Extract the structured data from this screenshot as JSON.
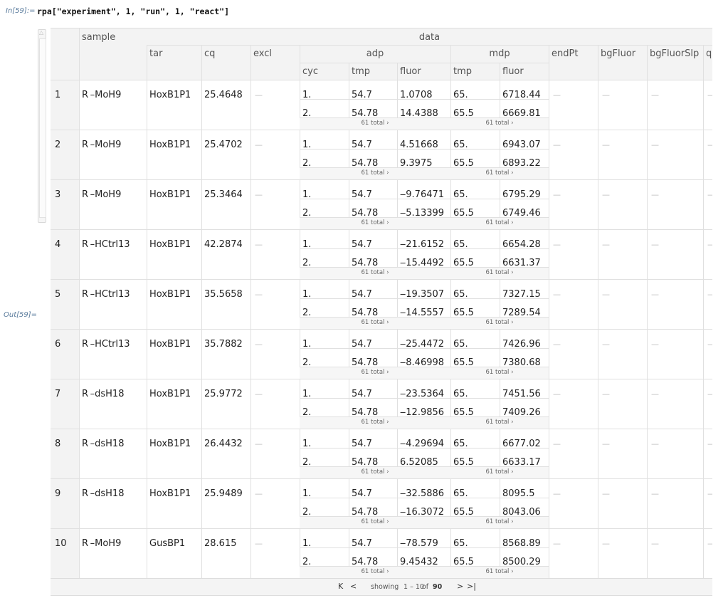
{
  "input": {
    "label": "In[59]:=",
    "code_fn": "rpa",
    "code_args": "[\"experiment\", 1, \"run\", 1, \"react\"]"
  },
  "output": {
    "label": "Out[59]="
  },
  "header": {
    "sample": "sample",
    "data": "data",
    "tar": "tar",
    "cq": "cq",
    "excl": "excl",
    "adp": "adp",
    "mdp": "mdp",
    "endPt": "endPt",
    "bgFluor": "bgFluor",
    "bgFluorSlp": "bgFluorSlp",
    "q": "q",
    "cyc": "cyc",
    "tmp": "tmp",
    "fluor": "fluor"
  },
  "dash": "—",
  "total_label": "61 total ›",
  "rows": [
    {
      "n": "1",
      "sample": "R –MoH9",
      "tar": "HoxB1P1",
      "cq": "25.4648",
      "adp": [
        [
          "1.",
          "54.7",
          "1.0708"
        ],
        [
          "2.",
          "54.78",
          "14.4388"
        ]
      ],
      "mdp": [
        [
          "65.",
          "6718.44"
        ],
        [
          "65.5",
          "6669.81"
        ]
      ]
    },
    {
      "n": "2",
      "sample": "R –MoH9",
      "tar": "HoxB1P1",
      "cq": "25.4702",
      "adp": [
        [
          "1.",
          "54.7",
          "4.51668"
        ],
        [
          "2.",
          "54.78",
          "9.3975"
        ]
      ],
      "mdp": [
        [
          "65.",
          "6943.07"
        ],
        [
          "65.5",
          "6893.22"
        ]
      ]
    },
    {
      "n": "3",
      "sample": "R –MoH9",
      "tar": "HoxB1P1",
      "cq": "25.3464",
      "adp": [
        [
          "1.",
          "54.7",
          "‒9.76471"
        ],
        [
          "2.",
          "54.78",
          "‒5.13399"
        ]
      ],
      "mdp": [
        [
          "65.",
          "6795.29"
        ],
        [
          "65.5",
          "6749.46"
        ]
      ]
    },
    {
      "n": "4",
      "sample": "R –HCtrl13",
      "tar": "HoxB1P1",
      "cq": "42.2874",
      "adp": [
        [
          "1.",
          "54.7",
          "‒21.6152"
        ],
        [
          "2.",
          "54.78",
          "‒15.4492"
        ]
      ],
      "mdp": [
        [
          "65.",
          "6654.28"
        ],
        [
          "65.5",
          "6631.37"
        ]
      ]
    },
    {
      "n": "5",
      "sample": "R –HCtrl13",
      "tar": "HoxB1P1",
      "cq": "35.5658",
      "adp": [
        [
          "1.",
          "54.7",
          "‒19.3507"
        ],
        [
          "2.",
          "54.78",
          "‒14.5557"
        ]
      ],
      "mdp": [
        [
          "65.",
          "7327.15"
        ],
        [
          "65.5",
          "7289.54"
        ]
      ]
    },
    {
      "n": "6",
      "sample": "R –HCtrl13",
      "tar": "HoxB1P1",
      "cq": "35.7882",
      "adp": [
        [
          "1.",
          "54.7",
          "‒25.4472"
        ],
        [
          "2.",
          "54.78",
          "‒8.46998"
        ]
      ],
      "mdp": [
        [
          "65.",
          "7426.96"
        ],
        [
          "65.5",
          "7380.68"
        ]
      ]
    },
    {
      "n": "7",
      "sample": "R –dsH18",
      "tar": "HoxB1P1",
      "cq": "25.9772",
      "adp": [
        [
          "1.",
          "54.7",
          "‒23.5364"
        ],
        [
          "2.",
          "54.78",
          "‒12.9856"
        ]
      ],
      "mdp": [
        [
          "65.",
          "7451.56"
        ],
        [
          "65.5",
          "7409.26"
        ]
      ]
    },
    {
      "n": "8",
      "sample": "R –dsH18",
      "tar": "HoxB1P1",
      "cq": "26.4432",
      "adp": [
        [
          "1.",
          "54.7",
          "‒4.29694"
        ],
        [
          "2.",
          "54.78",
          "6.52085"
        ]
      ],
      "mdp": [
        [
          "65.",
          "6677.02"
        ],
        [
          "65.5",
          "6633.17"
        ]
      ]
    },
    {
      "n": "9",
      "sample": "R –dsH18",
      "tar": "HoxB1P1",
      "cq": "25.9489",
      "adp": [
        [
          "1.",
          "54.7",
          "‒32.5886"
        ],
        [
          "2.",
          "54.78",
          "‒16.3072"
        ]
      ],
      "mdp": [
        [
          "65.",
          "8095.5"
        ],
        [
          "65.5",
          "8043.06"
        ]
      ]
    },
    {
      "n": "10",
      "sample": "R –MoH9",
      "tar": "GusBP1",
      "cq": "28.615",
      "adp": [
        [
          "1.",
          "54.7",
          "‒78.579"
        ],
        [
          "2.",
          "54.78",
          "9.45432"
        ]
      ],
      "mdp": [
        [
          "65.",
          "8568.89"
        ],
        [
          "65.5",
          "8500.29"
        ]
      ]
    }
  ],
  "footer": {
    "showing": "showing",
    "range": "1 – 10",
    "of": "of",
    "count": "90",
    "first_icon": "first-page-icon",
    "prev_icon": "prev-page-icon",
    "next_icon": "next-page-icon",
    "last_icon": "last-page-icon"
  }
}
